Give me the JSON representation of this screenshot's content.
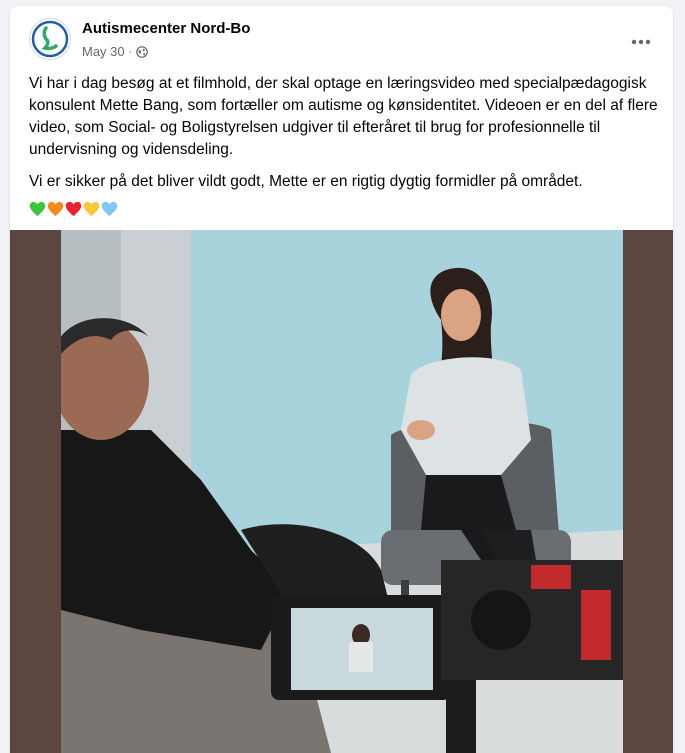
{
  "post": {
    "page_name": "Autismecenter Nord-Bo",
    "date": "May 30",
    "separator": "·",
    "audience_icon": "globe-icon",
    "more_icon": "more-options-icon",
    "paragraphs": [
      "Vi har i dag besøg at et filmhold, der skal optage en læringsvideo med specialpædagogisk konsulent Mette Bang, som fortæller om autisme og kønsidentitet. Videoen er en del af flere video, som Social- og Boligstyrelsen udgiver til efteråret til brug for profesionnelle til undervisning og vidensdeling.",
      "Vi er sikker på det bliver vildt godt, Mette er en rigtig dygtig formidler på området."
    ],
    "hearts": [
      {
        "name": "green-heart-icon",
        "color": "#3fc43f"
      },
      {
        "name": "orange-heart-icon",
        "color": "#f58b1f"
      },
      {
        "name": "red-heart-icon",
        "color": "#e8222f"
      },
      {
        "name": "yellow-heart-icon",
        "color": "#f7c83a"
      },
      {
        "name": "blue-heart-icon",
        "color": "#7fc8ee"
      }
    ]
  },
  "colors": {
    "text_primary": "#050505",
    "text_secondary": "#65676b",
    "photo_border": "#5b4740",
    "studio_backdrop": "#a9d3dc"
  }
}
